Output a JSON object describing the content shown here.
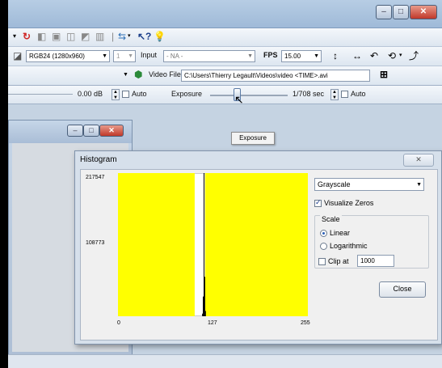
{
  "toolbar": {
    "format_value": "RGB24 (1280x960)",
    "zoom_value": "1",
    "input_label": "Input",
    "input_value": "- NA -",
    "fps_label": "FPS",
    "fps_value": "15.00",
    "video_file_label": "Video File",
    "video_file_path": "C:\\Users\\Thierry Legault\\Videos\\video <TIME>.avi",
    "gain_value": "0.00 dB",
    "auto_label_1": "Auto",
    "exposure_label": "Exposure",
    "exposure_value": "1/708 sec",
    "auto_label_2": "Auto"
  },
  "tooltip": {
    "text": "Exposure"
  },
  "histogram": {
    "title": "Histogram",
    "mode_value": "Grayscale",
    "visualize_zeros_label": "Visualize Zeros",
    "visualize_zeros_checked": true,
    "scale_group_label": "Scale",
    "linear_label": "Linear",
    "logarithmic_label": "Logarithmic",
    "selected_scale": "Linear",
    "clip_label": "Clip at",
    "clip_value": "1000",
    "clip_checked": false,
    "close_label": "Close",
    "close_x": "✕"
  },
  "chart_data": {
    "type": "bar",
    "x_ticks": [
      "0",
      "127",
      "255"
    ],
    "y_ticks": [
      "217547",
      "108773"
    ],
    "xlim": [
      0,
      255
    ],
    "ylim": [
      0,
      217547
    ],
    "fill_color": "#ffff00",
    "bar_color": "#000000",
    "yellow_ranges": [
      [
        0,
        103
      ],
      [
        117,
        255
      ]
    ],
    "peak_bins": [
      {
        "x": 113,
        "v": 4000
      },
      {
        "x": 114,
        "v": 30000
      },
      {
        "x": 115,
        "v": 217547
      },
      {
        "x": 116,
        "v": 60000
      },
      {
        "x": 117,
        "v": 8000
      }
    ]
  },
  "colors": {
    "accent": "#2b5fb8",
    "yellow": "#ffff00"
  }
}
